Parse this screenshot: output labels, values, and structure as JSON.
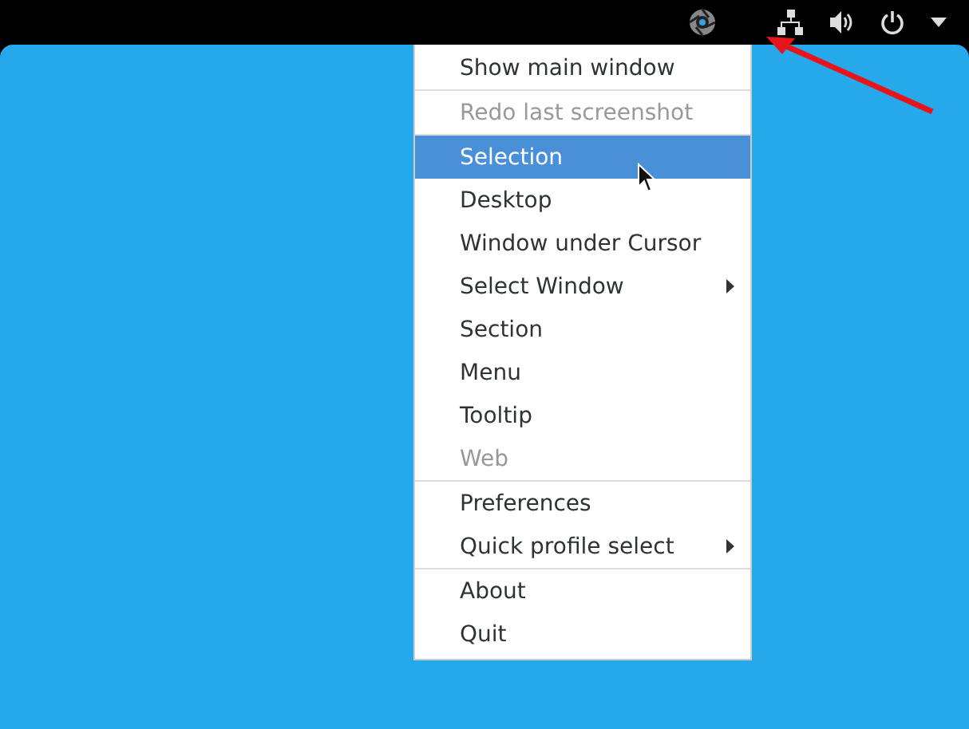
{
  "menu": {
    "sections": [
      {
        "items": [
          {
            "label": "Show main window",
            "disabled": false,
            "selected": false,
            "submenu": false
          }
        ]
      },
      {
        "items": [
          {
            "label": "Redo last screenshot",
            "disabled": true,
            "selected": false,
            "submenu": false
          }
        ]
      },
      {
        "items": [
          {
            "label": "Selection",
            "disabled": false,
            "selected": true,
            "submenu": false
          },
          {
            "label": "Desktop",
            "disabled": false,
            "selected": false,
            "submenu": false
          },
          {
            "label": "Window under Cursor",
            "disabled": false,
            "selected": false,
            "submenu": false
          },
          {
            "label": "Select Window",
            "disabled": false,
            "selected": false,
            "submenu": true
          },
          {
            "label": "Section",
            "disabled": false,
            "selected": false,
            "submenu": false
          },
          {
            "label": "Menu",
            "disabled": false,
            "selected": false,
            "submenu": false
          },
          {
            "label": "Tooltip",
            "disabled": false,
            "selected": false,
            "submenu": false
          },
          {
            "label": "Web",
            "disabled": true,
            "selected": false,
            "submenu": false
          }
        ]
      },
      {
        "items": [
          {
            "label": "Preferences",
            "disabled": false,
            "selected": false,
            "submenu": false
          },
          {
            "label": "Quick profile select",
            "disabled": false,
            "selected": false,
            "submenu": true
          }
        ]
      },
      {
        "items": [
          {
            "label": "About",
            "disabled": false,
            "selected": false,
            "submenu": false
          },
          {
            "label": "Quit",
            "disabled": false,
            "selected": false,
            "submenu": false
          }
        ]
      }
    ]
  }
}
